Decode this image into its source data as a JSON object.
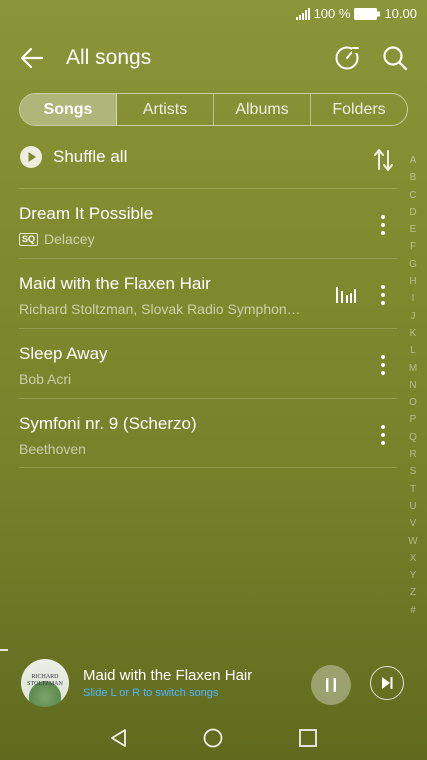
{
  "status": {
    "battery_percent": "100 %",
    "time": "10.00"
  },
  "header": {
    "title": "All songs"
  },
  "tabs": [
    {
      "label": "Songs",
      "active": true
    },
    {
      "label": "Artists",
      "active": false
    },
    {
      "label": "Albums",
      "active": false
    },
    {
      "label": "Folders",
      "active": false
    }
  ],
  "shuffle": {
    "label": "Shuffle all"
  },
  "songs": [
    {
      "title": "Dream It Possible",
      "artist": "Delacey",
      "badge": "SQ",
      "playing": false
    },
    {
      "title": "Maid with the Flaxen Hair",
      "artist": "Richard Stoltzman, Slovak Radio Symphon…",
      "badge": "",
      "playing": true
    },
    {
      "title": "Sleep Away",
      "artist": "Bob Acri",
      "badge": "",
      "playing": false
    },
    {
      "title": "Symfoni nr. 9 (Scherzo)",
      "artist": "Beethoven",
      "badge": "",
      "playing": false
    }
  ],
  "alphabet": [
    "A",
    "B",
    "C",
    "D",
    "E",
    "F",
    "G",
    "H",
    "I",
    "J",
    "K",
    "L",
    "M",
    "N",
    "O",
    "P",
    "Q",
    "R",
    "S",
    "T",
    "U",
    "V",
    "W",
    "X",
    "Y",
    "Z",
    "#"
  ],
  "mini_player": {
    "title": "Maid with the Flaxen Hair",
    "hint": "Slide L or R to switch songs",
    "album_art_text": "RICHARD STOLTZMAN"
  },
  "colors": {
    "hint_blue": "#4fb3ff",
    "background": "#7f8a2e"
  }
}
